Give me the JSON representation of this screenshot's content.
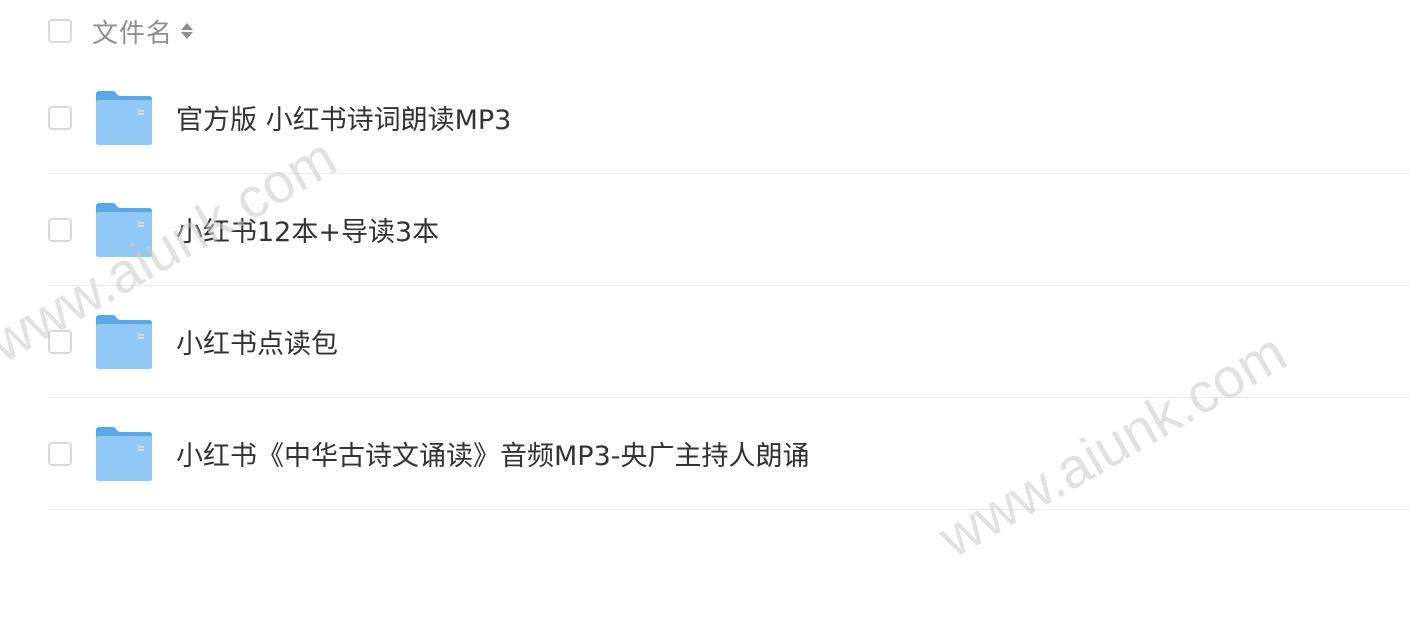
{
  "header": {
    "column_label": "文件名",
    "sort_icon": "sort-updown-icon"
  },
  "files": [
    {
      "name": "官方版 小红书诗词朗读MP3",
      "icon": "folder-icon"
    },
    {
      "name": "小红书12本+导读3本",
      "icon": "folder-icon"
    },
    {
      "name": "小红书点读包",
      "icon": "folder-icon"
    },
    {
      "name": "小红书《中华古诗文诵读》音频MP3-央广主持人朗诵",
      "icon": "folder-icon"
    }
  ],
  "watermark": {
    "text": "www.aiunk.com"
  },
  "colors": {
    "folder_back": "#5aa7e8",
    "folder_front": "#8fc8f4",
    "text": "#333333",
    "header_text": "#8f8f8f",
    "divider": "#ededed"
  }
}
